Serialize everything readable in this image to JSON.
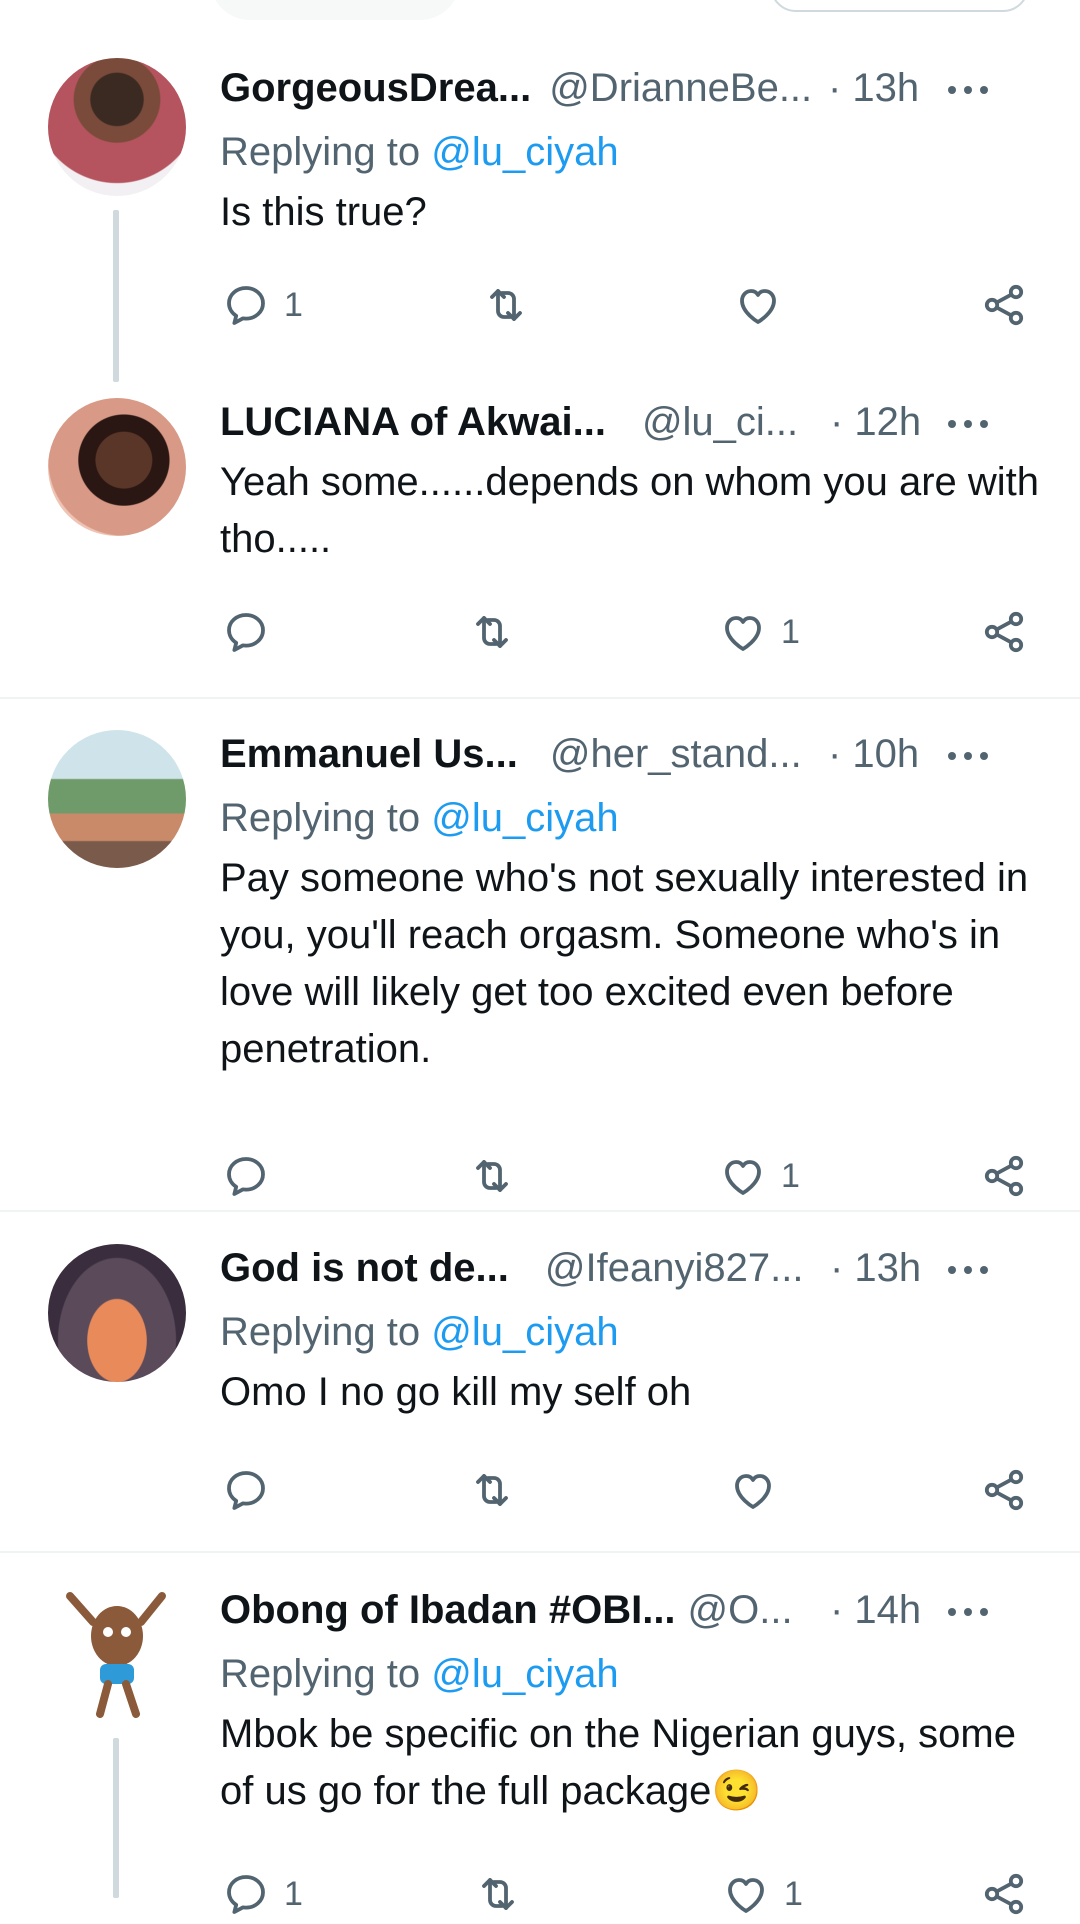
{
  "colors": {
    "accent": "#1d9bf0",
    "secondary_text": "#536471",
    "primary_text": "#0f1419",
    "divider": "#eff3f4"
  },
  "tweets": [
    {
      "name": "GorgeousDrea...",
      "handle": "@DrianneBe...",
      "time": "· 13h",
      "replying_prefix": "Replying to",
      "replying_mention": "@lu_ciyah",
      "text": "Is this true?",
      "reply_count": "1",
      "retweet_count": "",
      "like_count": ""
    },
    {
      "name": "LUCIANA of Akwai...",
      "handle": "@lu_ci...",
      "time": "· 12h",
      "text": "Yeah some......depends on whom you are with tho.....",
      "reply_count": "",
      "retweet_count": "",
      "like_count": "1"
    },
    {
      "name": "Emmanuel Us...",
      "handle": "@her_stand...",
      "time": "· 10h",
      "replying_prefix": "Replying to",
      "replying_mention": "@lu_ciyah",
      "text": "Pay someone who's not sexually interested in you, you'll reach orgasm. Someone who's in love will likely get too excited even before penetration.",
      "reply_count": "",
      "retweet_count": "",
      "like_count": "1"
    },
    {
      "name": "God is not de...",
      "handle": "@Ifeanyi827...",
      "time": "· 13h",
      "replying_prefix": "Replying to",
      "replying_mention": "@lu_ciyah",
      "text": "Omo I no go kill my self oh",
      "reply_count": "",
      "retweet_count": "",
      "like_count": ""
    },
    {
      "name": "Obong of Ibadan #OBI...",
      "handle": "@O...",
      "time": "· 14h",
      "replying_prefix": "Replying to",
      "replying_mention": "@lu_ciyah",
      "text": "Mbok be specific on the Nigerian guys, some of us go for the full package",
      "emoji": "😉",
      "reply_count": "1",
      "retweet_count": "",
      "like_count": "1"
    }
  ],
  "icons": [
    "reply-icon",
    "retweet-icon",
    "like-icon",
    "share-icon",
    "more-icon"
  ]
}
